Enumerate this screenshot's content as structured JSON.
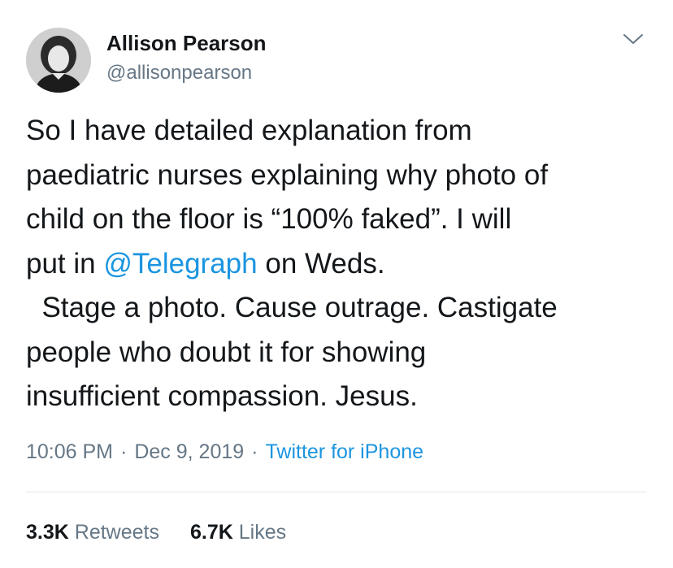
{
  "author": {
    "display_name": "Allison Pearson",
    "handle": "@allisonpearson"
  },
  "tweet": {
    "line1": "So I have detailed explanation from",
    "line2": "paediatric nurses explaining why photo of",
    "line3": "child on the floor is “100% faked”. I will",
    "line4_pre": "put in ",
    "mention": "@Telegraph",
    "line4_post": " on Weds.",
    "line5": "  Stage a photo. Cause outrage. Castigate",
    "line6": "people who doubt it for showing",
    "line7": "insufficient compassion. Jesus."
  },
  "meta": {
    "time": "10:06 PM",
    "separator": "·",
    "date": "Dec 9, 2019",
    "source": "Twitter for iPhone"
  },
  "stats": {
    "retweets_count": "3.3K",
    "retweets_label": "Retweets",
    "likes_count": "6.7K",
    "likes_label": "Likes"
  },
  "colors": {
    "link": "#1b95e0",
    "secondary_text": "#657786",
    "primary_text": "#14171a",
    "divider": "#e1e8ed"
  },
  "icons": {
    "menu": "chevron-down-icon"
  }
}
